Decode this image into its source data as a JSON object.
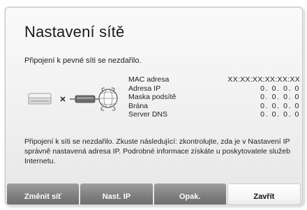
{
  "dialog": {
    "title": "Nastavení sítě",
    "subtitle": "Připojení k pevné síti se nezdařilo.",
    "info": [
      {
        "label": "MAC adresa",
        "value": "XX:XX:XX:XX:XX:XX"
      },
      {
        "label": "Adresa IP",
        "value": "0.  0.  0.  0"
      },
      {
        "label": "Maska podsítě",
        "value": "0.  0.  0.  0"
      },
      {
        "label": "Brána",
        "value": "0.  0.  0.  0"
      },
      {
        "label": "Server DNS",
        "value": "0.  0.  0.  0"
      }
    ],
    "message": "Připojení k síti se nezdařilo. Zkuste následující: zkontrolujte, zda je v Nastavení IP správně nastavená adresa IP. Podrobné informace získáte u poskytovatele služeb Internetu.",
    "buttons": {
      "change_network": "Změnit síť",
      "ip_settings": "Nast. IP",
      "retry": "Opak.",
      "close": "Zavřít"
    },
    "status_icons": [
      "tv-device-icon",
      "disconnected-x-icon",
      "cable-modem-icon",
      "globe-icon"
    ]
  }
}
